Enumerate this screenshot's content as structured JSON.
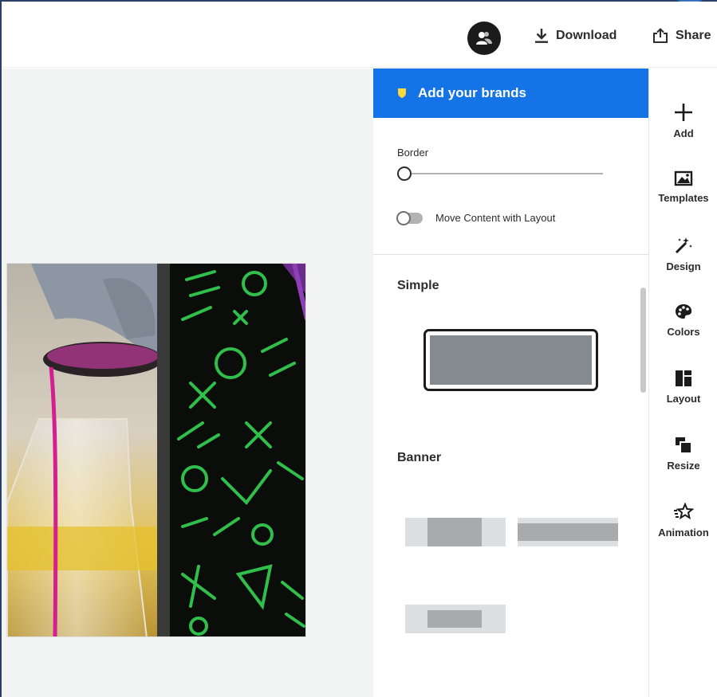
{
  "header": {
    "download_label": "Download",
    "share_label": "Share"
  },
  "panel": {
    "brand_label": "Add your brands",
    "border_label": "Border",
    "border_value": 0,
    "toggle_label": "Move Content with Layout",
    "toggle_on": false,
    "simple_title": "Simple",
    "banner_title": "Banner"
  },
  "rail": {
    "items": [
      {
        "label": "Add",
        "icon": "plus-icon"
      },
      {
        "label": "Templates",
        "icon": "templates-icon"
      },
      {
        "label": "Design",
        "icon": "magic-wand-icon"
      },
      {
        "label": "Colors",
        "icon": "palette-icon"
      },
      {
        "label": "Layout",
        "icon": "layout-icon"
      },
      {
        "label": "Resize",
        "icon": "resize-icon"
      },
      {
        "label": "Animation",
        "icon": "animation-icon"
      }
    ]
  },
  "colors": {
    "accent": "#1473e6",
    "brand_icon": "#f7d940",
    "preview_fill": "#858a8f"
  }
}
